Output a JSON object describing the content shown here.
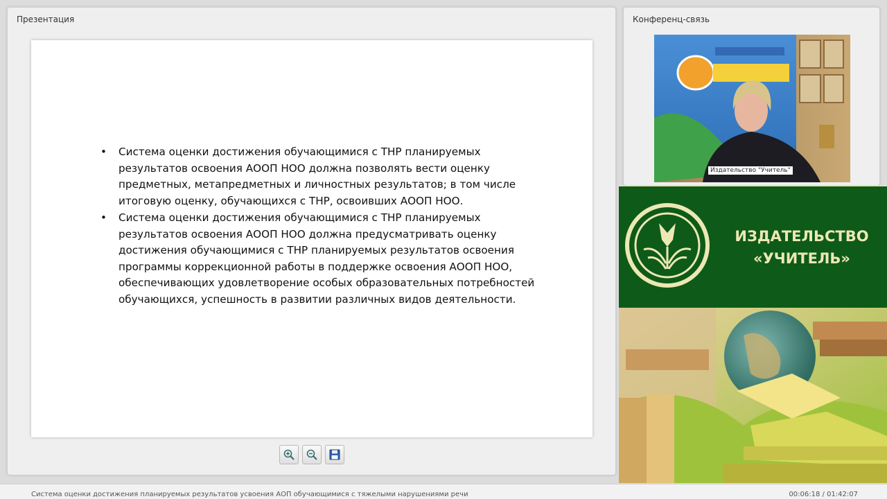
{
  "presentation_panel": {
    "title": "Презентация",
    "slide": {
      "bullets": [
        "Система оценки достижения обучающимися с ТНР планируемых результатов освоения АООП НОО должна позволять вести оценку предметных, метапредметных и личностных результатов; в том числе итоговую оценку, обучающихся с ТНР, освоивших АООП НОО.",
        "Система оценки достижения обучающимися с ТНР планируемых результатов освоения АООП НОО должна предусматривать оценку достижения обучающимися с ТНР планируемых результатов освоения программы коррекционной работы в поддержке освоения АООП НОО, обеспечивающих удовлетворение особых образовательных потребностей обучающихся, успешность в развитии различных видов деятельности."
      ]
    },
    "toolbar": {
      "zoom_in_icon": "zoom-in-icon",
      "zoom_out_icon": "zoom-out-icon",
      "save_icon": "save-icon"
    }
  },
  "conference_panel": {
    "title": "Конференц-связь",
    "video_caption": "Издательство \"Учитель\""
  },
  "banner": {
    "line1": "ИЗДАТЕЛЬСТВО",
    "line2": "«УЧИТЕЛЬ»",
    "background_color": "#0e5a19",
    "text_color": "#ece8b4"
  },
  "status_bar": {
    "title": "Система оценки достижения планируемых результатов усвоения АОП обучающимися с тяжелыми нарушениями речи",
    "time": "00:06:18 / 01:42:07"
  }
}
